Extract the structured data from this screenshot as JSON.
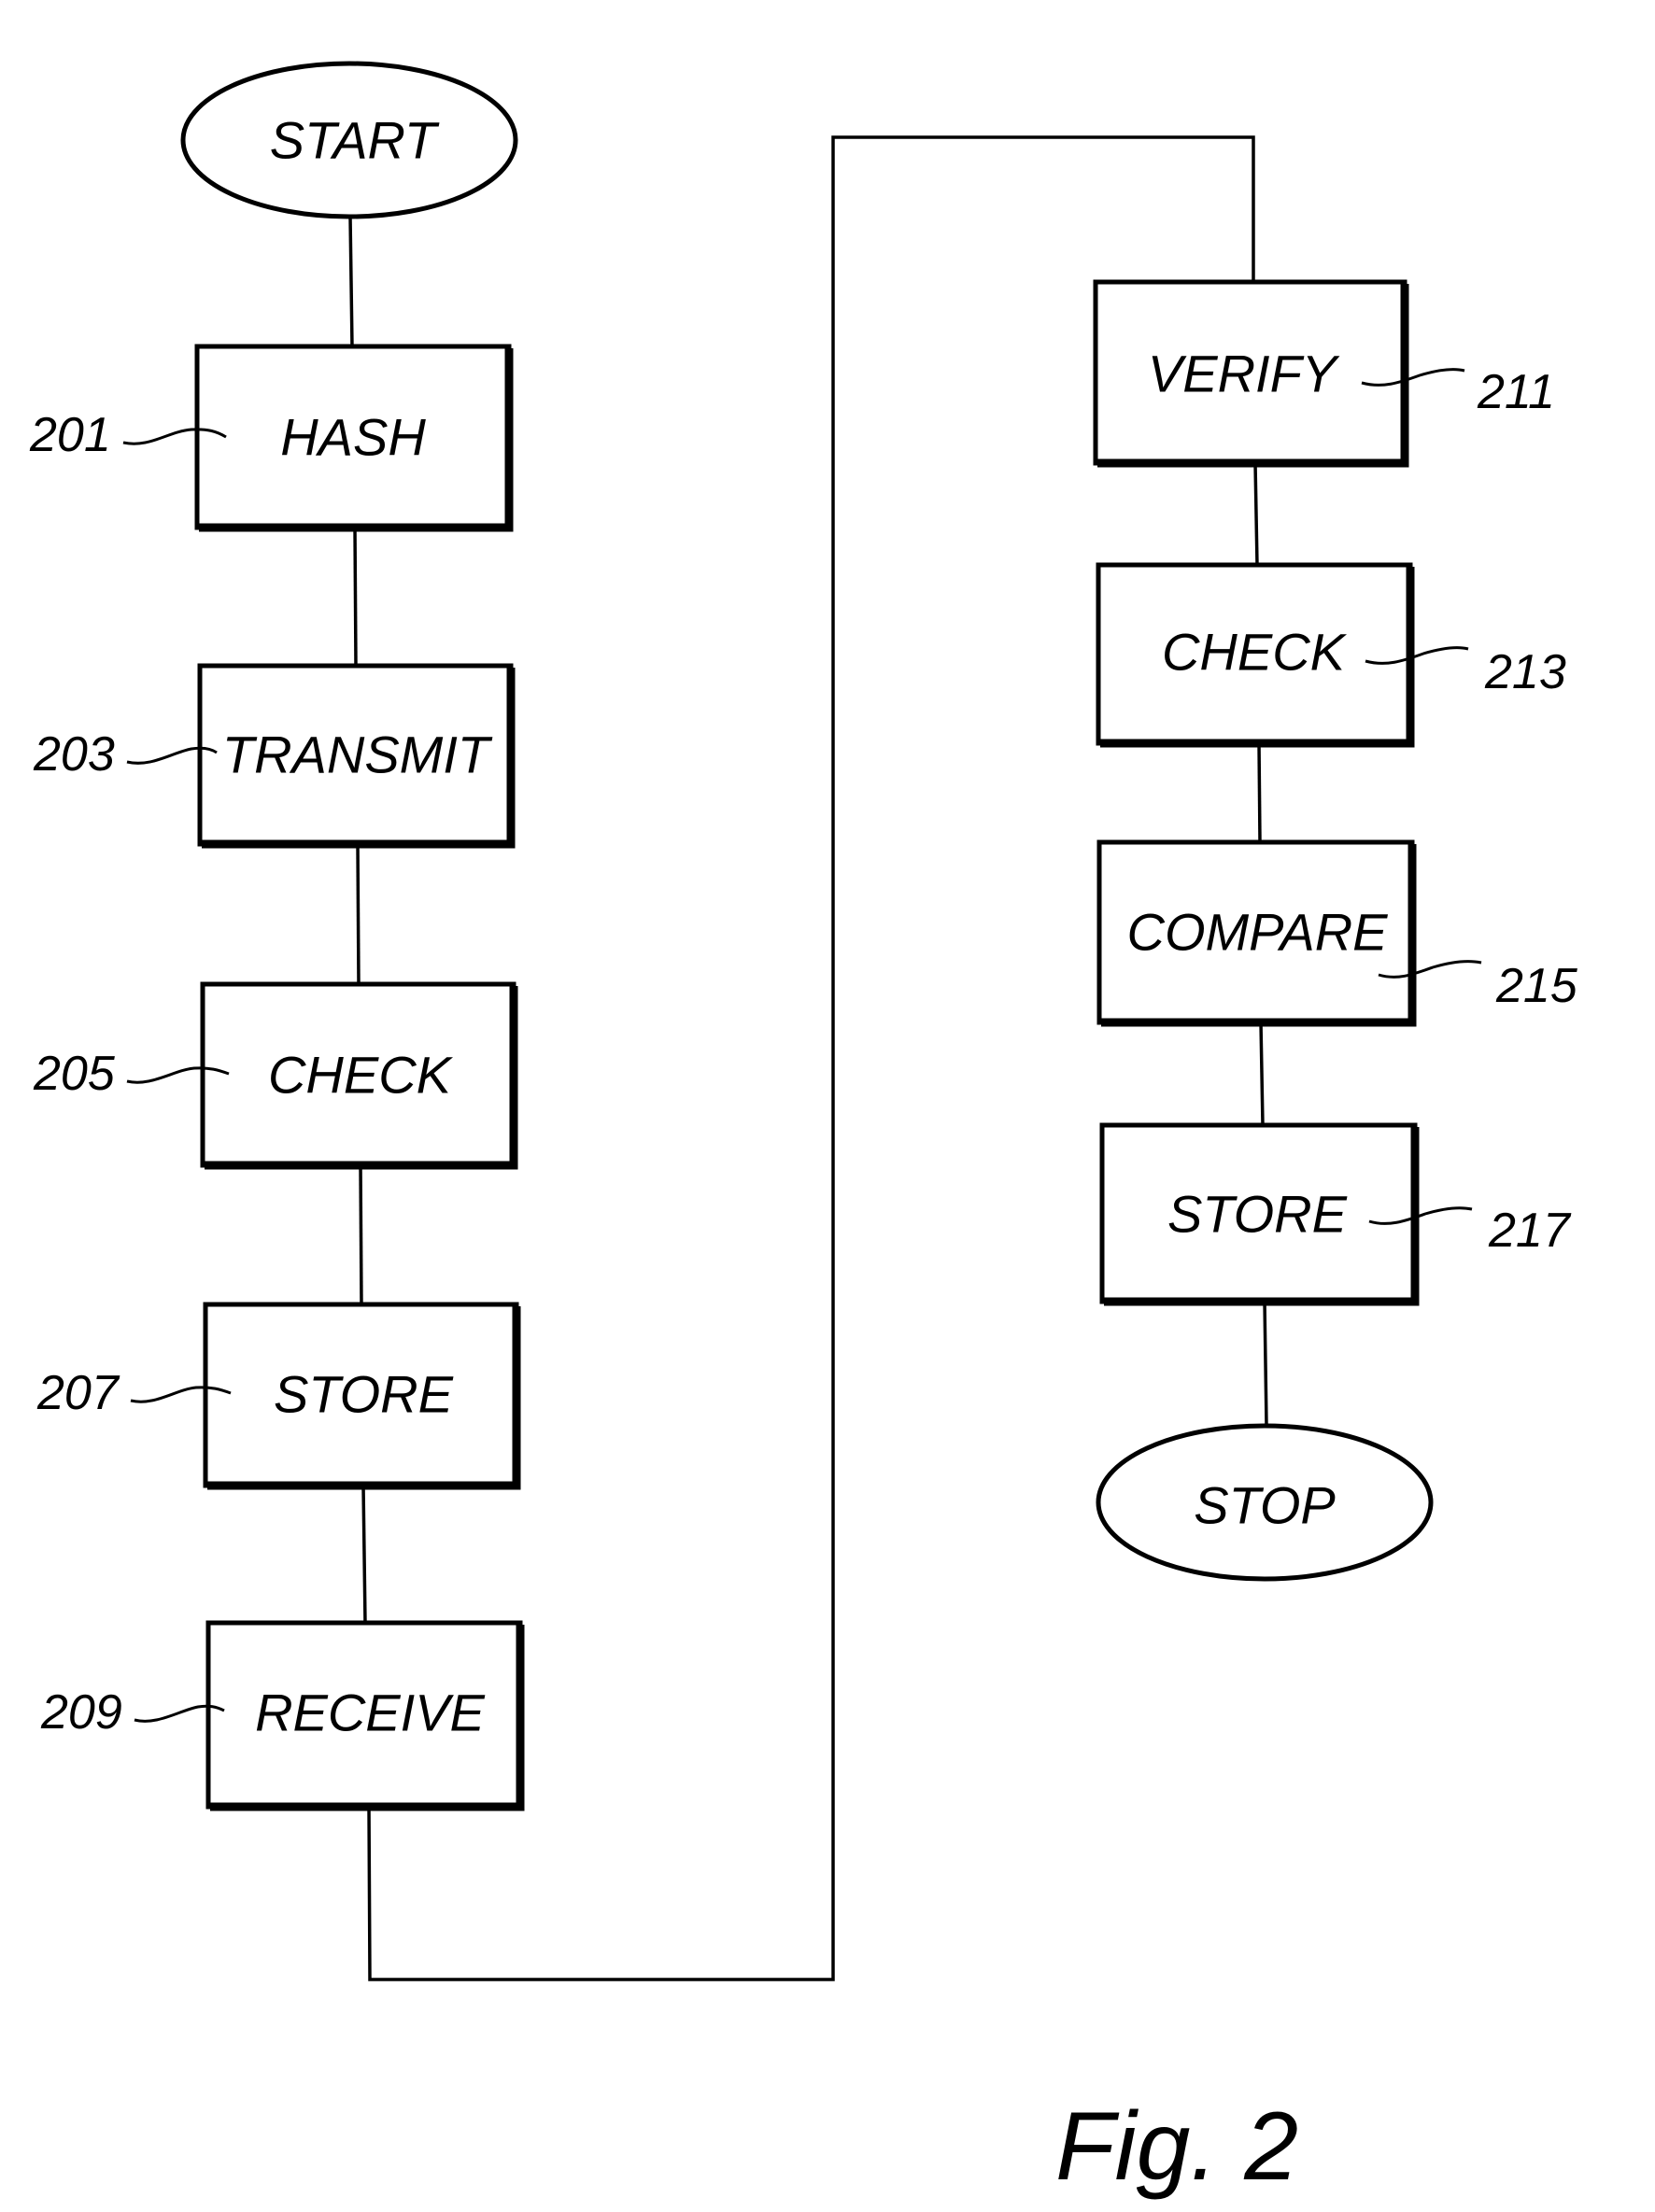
{
  "figure": {
    "caption": "Fig. 2",
    "type": "flowchart"
  },
  "terminals": {
    "start": "START",
    "stop": "STOP"
  },
  "steps": [
    {
      "id": "201",
      "label": "HASH"
    },
    {
      "id": "203",
      "label": "TRANSMIT"
    },
    {
      "id": "205",
      "label": "CHECK"
    },
    {
      "id": "207",
      "label": "STORE"
    },
    {
      "id": "209",
      "label": "RECEIVE"
    },
    {
      "id": "211",
      "label": "VERIFY"
    },
    {
      "id": "213",
      "label": "CHECK"
    },
    {
      "id": "215",
      "label": "COMPARE"
    },
    {
      "id": "217",
      "label": "STORE"
    }
  ],
  "flow": [
    "START",
    "201",
    "203",
    "205",
    "207",
    "209",
    "211",
    "213",
    "215",
    "217",
    "STOP"
  ]
}
